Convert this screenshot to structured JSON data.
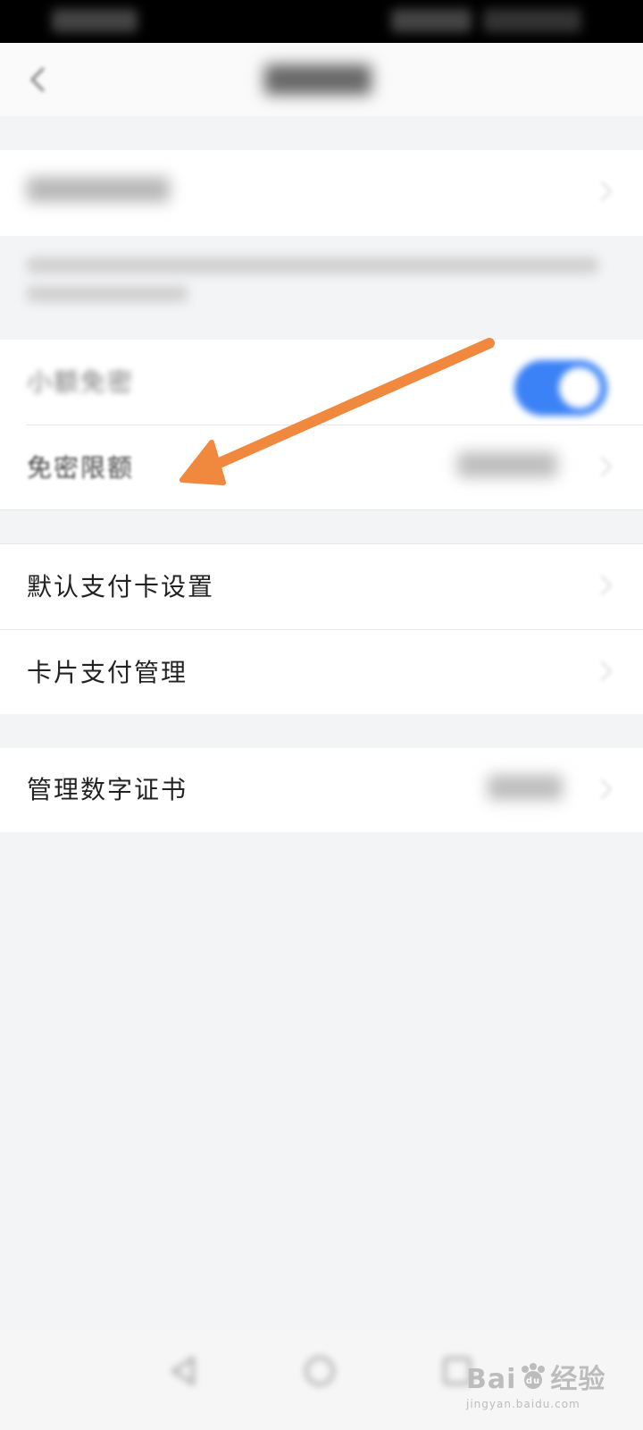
{
  "colors": {
    "page_background": "#f3f4f6",
    "card_background": "#ffffff",
    "toggle_on": "#3b82f6",
    "annotation_arrow": "#f0883e",
    "status_bar": "#000000"
  },
  "sections": {
    "limits": {
      "small_amount": {
        "label": "小额免密",
        "toggle_on": true
      },
      "limit": {
        "label": "免密限额"
      }
    },
    "cards": {
      "default_card": {
        "label": "默认支付卡设置"
      },
      "card_payment": {
        "label": "卡片支付管理"
      }
    },
    "certificate": {
      "manage": {
        "label": "管理数字证书"
      }
    }
  },
  "icons": {
    "back": "chevron-left",
    "row_chevron": "chevron-right",
    "nav_back": "triangle-left",
    "nav_home": "circle",
    "nav_recent": "square"
  },
  "watermark": {
    "main_left": "Bai",
    "main_right": "经验",
    "paw_text": "du",
    "sub": "jingyan.baidu.com"
  }
}
